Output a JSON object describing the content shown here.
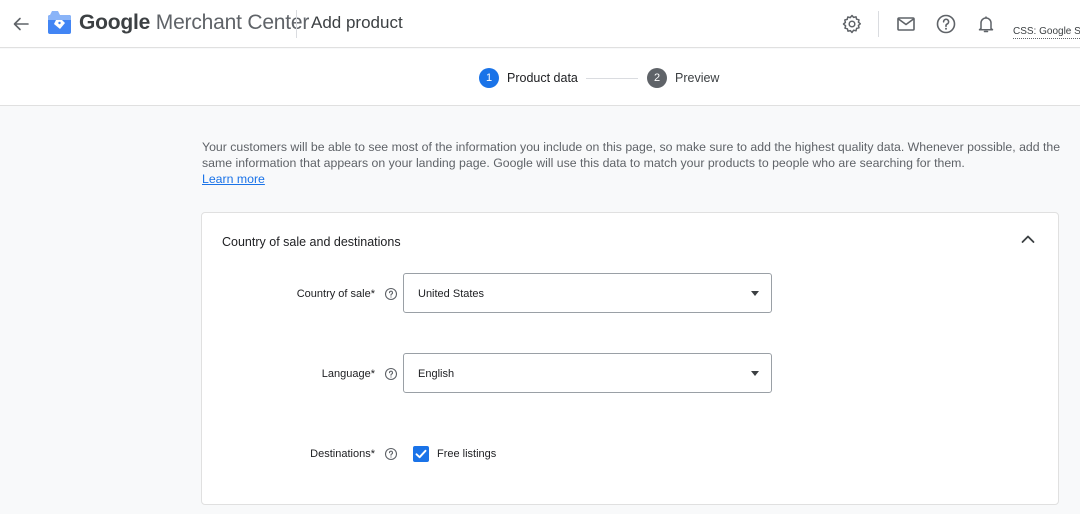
{
  "header": {
    "brand_google": "Google",
    "brand_product": "Merchant Center",
    "page_title": "Add product",
    "account_label": "CSS: Google Sh"
  },
  "icons": {
    "back": "arrow-back-icon",
    "logo": "merchant-center-logo",
    "settings": "gear-icon",
    "mail": "mail-icon",
    "help": "help-icon",
    "notifications": "bell-icon",
    "collapse": "chevron-up-icon",
    "field_help": "help-icon"
  },
  "stepper": {
    "steps": [
      {
        "number": "1",
        "label": "Product data",
        "active": true
      },
      {
        "number": "2",
        "label": "Preview",
        "active": false
      }
    ]
  },
  "intro": {
    "text": "Your customers will be able to see most of the information you include on this page, so make sure to add the highest quality data. Whenever possible, add the same information that appears on your landing page. Google will use this data to match your products to people who are searching for them.",
    "learn_more": "Learn more"
  },
  "section": {
    "title": "Country of sale and destinations",
    "fields": {
      "country": {
        "label": "Country of sale*",
        "value": "United States"
      },
      "language": {
        "label": "Language*",
        "value": "English"
      },
      "destinations": {
        "label": "Destinations*",
        "option_label": "Free listings",
        "checked": true
      }
    }
  },
  "colors": {
    "accent": "#1a73e8",
    "inactive_step": "#5f6368",
    "background": "#f8f9fa"
  }
}
